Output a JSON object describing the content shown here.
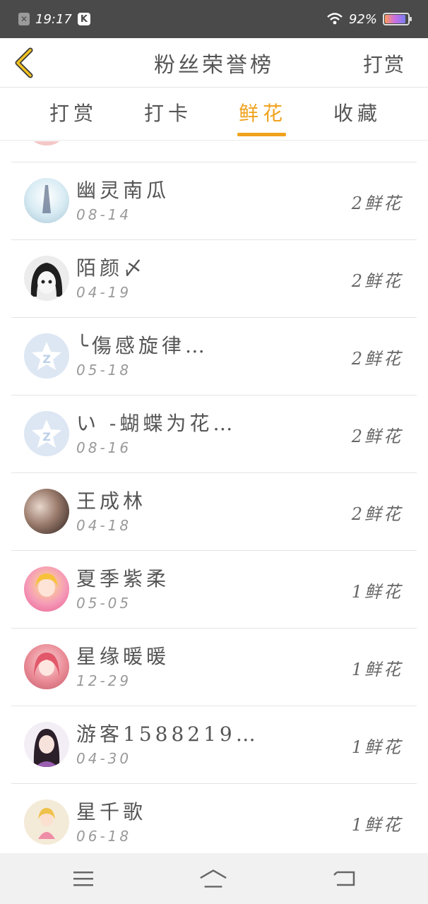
{
  "status": {
    "time": "19:17",
    "battery": "92%",
    "battery_level": 0.92
  },
  "nav": {
    "title": "粉丝荣誉榜",
    "action": "打赏"
  },
  "tabs": [
    {
      "label": "打赏",
      "active": false
    },
    {
      "label": "打卡",
      "active": false
    },
    {
      "label": "鲜花",
      "active": true
    },
    {
      "label": "收藏",
      "active": false
    }
  ],
  "colors": {
    "accent": "#f0a21c",
    "statusbar": "#4a4a4a"
  },
  "list": [
    {
      "name": "幽灵南瓜",
      "date": "08-14",
      "amount": "2鲜花",
      "avatar": "avatar-light"
    },
    {
      "name": "陌颜〆",
      "date": "04-19",
      "amount": "2鲜花",
      "avatar": "avatar-manga"
    },
    {
      "name": "╰傷感旋律…",
      "date": "05-18",
      "amount": "2鲜花",
      "avatar": "qq-default-icon"
    },
    {
      "name": "い -蝴蝶为花…",
      "date": "08-16",
      "amount": "2鲜花",
      "avatar": "qq-default-icon"
    },
    {
      "name": "王成林",
      "date": "04-18",
      "amount": "2鲜花",
      "avatar": "avatar-photo"
    },
    {
      "name": "夏季紫柔",
      "date": "05-05",
      "amount": "1鲜花",
      "avatar": "avatar-pink"
    },
    {
      "name": "星缘暖暖",
      "date": "12-29",
      "amount": "1鲜花",
      "avatar": "avatar-girl"
    },
    {
      "name": "游客1588219…",
      "date": "04-30",
      "amount": "1鲜花",
      "avatar": "avatar-portrait"
    },
    {
      "name": "星千歌",
      "date": "06-18",
      "amount": "1鲜花",
      "avatar": "avatar-figure"
    }
  ]
}
